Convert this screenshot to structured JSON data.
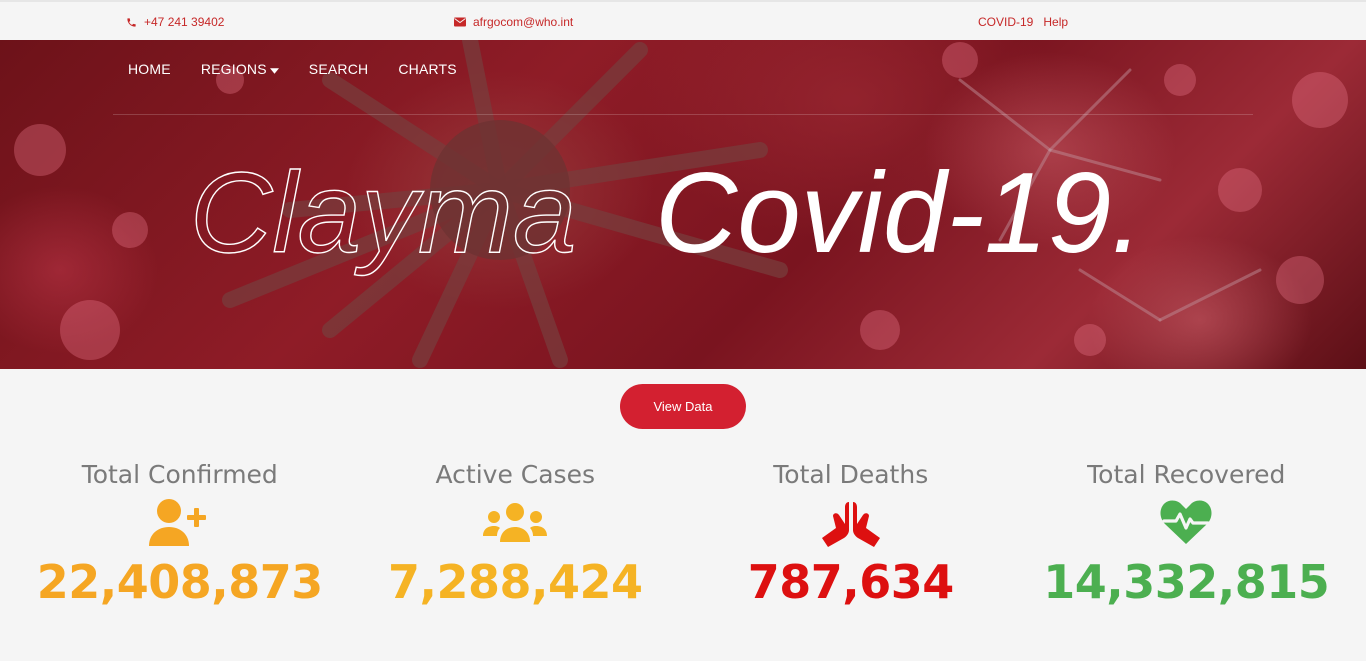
{
  "topbar": {
    "phone": "+47 241 39402",
    "email": "afrgocom@who.int",
    "links": [
      "COVID-19",
      "Help"
    ]
  },
  "nav": {
    "items": [
      "HOME",
      "REGIONS",
      "SEARCH",
      "CHARTS"
    ]
  },
  "hero": {
    "title_outline": "Clayma",
    "title_solid": "Covid-19."
  },
  "cta": {
    "label": "View Data"
  },
  "stats": [
    {
      "title": "Total Confirmed",
      "value": "22,408,873",
      "icon": "user-plus-icon",
      "color": "#f5a623"
    },
    {
      "title": "Active Cases",
      "value": "7,288,424",
      "icon": "users-group-icon",
      "color": "#f5b324"
    },
    {
      "title": "Total Deaths",
      "value": "787,634",
      "icon": "praying-hands-icon",
      "color": "#dd1010"
    },
    {
      "title": "Total Recovered",
      "value": "14,332,815",
      "icon": "heartbeat-icon",
      "color": "#4caf50"
    }
  ],
  "colors": {
    "accent": "#c62828",
    "button": "#d32030"
  }
}
